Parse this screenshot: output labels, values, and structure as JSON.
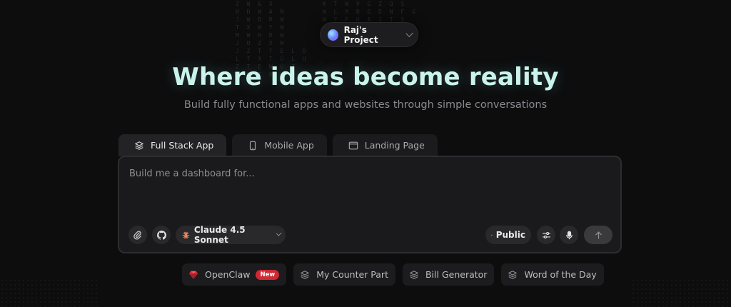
{
  "project": {
    "name": "Raj's Project"
  },
  "hero": {
    "title": "Where ideas become reality",
    "subtitle": "Build fully functional apps and websites through simple conversations"
  },
  "tabs": [
    {
      "label": "Full Stack App",
      "icon": "layers-icon",
      "active": true
    },
    {
      "label": "Mobile App",
      "icon": "phone-icon",
      "active": false
    },
    {
      "label": "Landing Page",
      "icon": "browser-window-icon",
      "active": false
    }
  ],
  "prompt": {
    "placeholder": "Build me a dashboard for...",
    "value": ""
  },
  "toolbar": {
    "attach_icon": "paperclip-icon",
    "github_icon": "github-icon",
    "model_label": "Claude 4.5 Sonnet",
    "model_icon": "claude-sunburst-icon",
    "visibility_label": "Public",
    "visibility_icon": "globe-icon",
    "settings_icon": "sliders-icon",
    "mic_icon": "microphone-icon",
    "send_icon": "arrow-up-icon"
  },
  "suggestions": [
    {
      "label": "OpenClaw",
      "icon": "ruby-gem-icon",
      "badge": "New"
    },
    {
      "label": "My Counter Part",
      "icon": "layers-icon"
    },
    {
      "label": "Bill Generator",
      "icon": "layers-icon"
    },
    {
      "label": "Word of the Day",
      "icon": "layers-icon"
    }
  ],
  "colors": {
    "background": "#0d0d0e",
    "hero_title": "#c9f3ec",
    "badge": "#d02834",
    "model_icon": "#e8875a"
  }
}
